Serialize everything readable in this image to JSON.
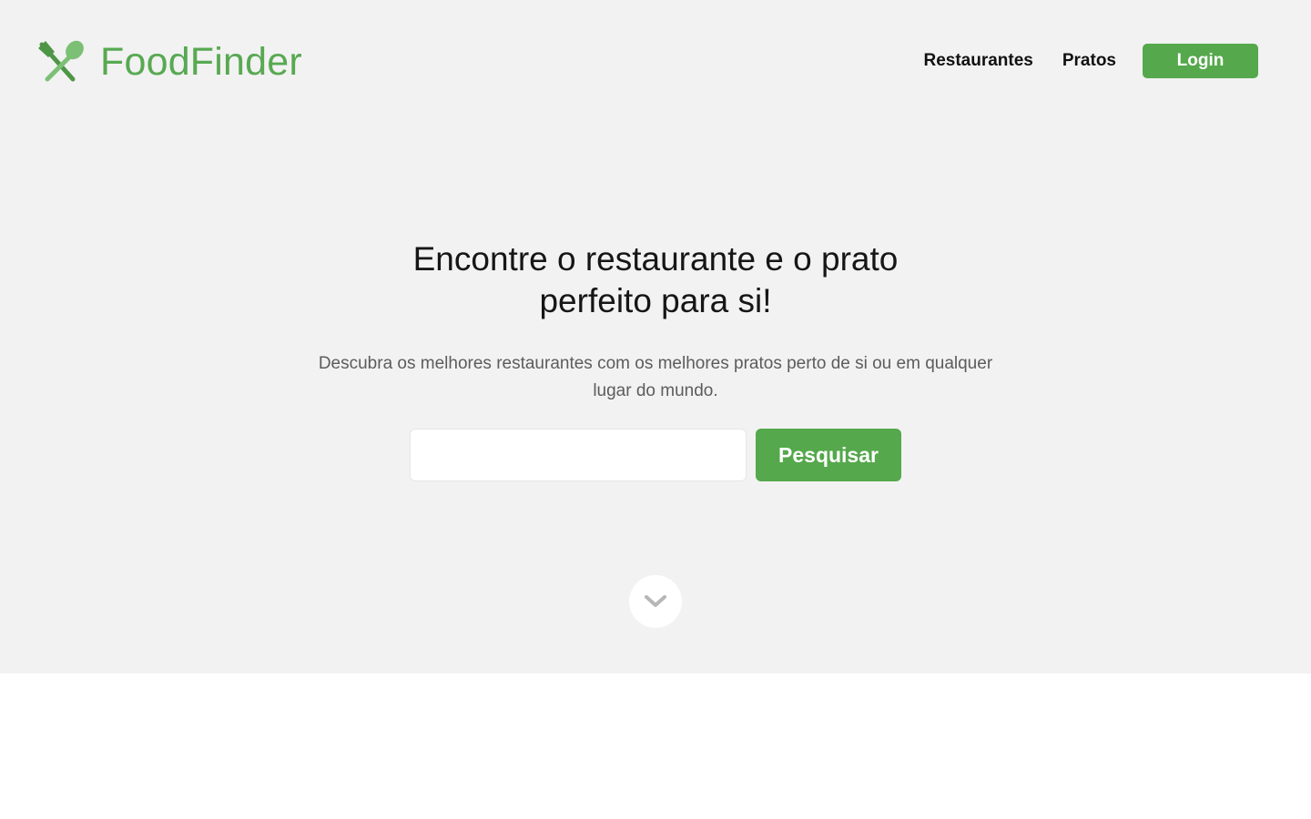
{
  "brand": {
    "name": "FoodFinder",
    "icon": "fork-spoon-icon",
    "color": "#58a952"
  },
  "nav": {
    "links": [
      "Restaurantes",
      "Pratos"
    ],
    "login_label": "Login"
  },
  "hero": {
    "title": "Encontre o restaurante e o prato perfeito para si!",
    "subtitle": "Descubra os melhores restaurantes com os melhores pratos perto de si ou em qualquer lugar do mundo.",
    "search": {
      "value": "",
      "placeholder": "",
      "button_label": "Pesquisar"
    },
    "scroll_icon": "chevron-down-icon"
  },
  "colors": {
    "accent": "#55a84c",
    "hero_background": "#f2f2f2",
    "page_background": "#ffffff"
  }
}
